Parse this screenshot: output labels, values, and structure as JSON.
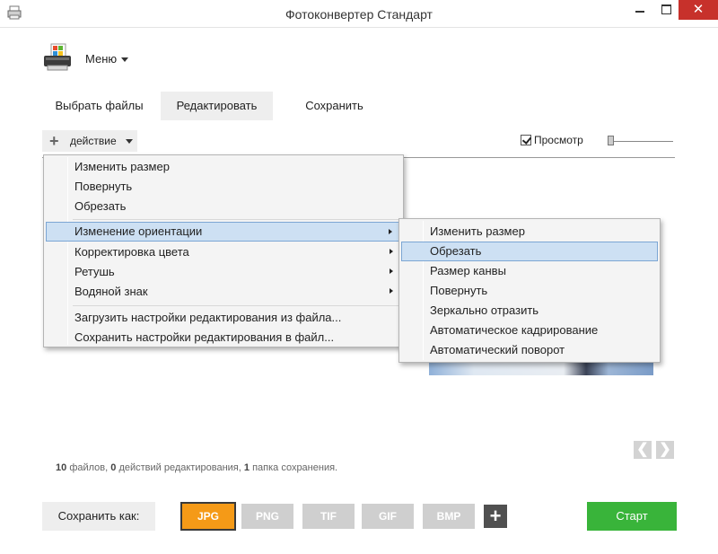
{
  "window": {
    "title": "Фотоконвертер Стандарт",
    "app_icon": "app-icon",
    "close_glyph": "✕"
  },
  "header": {
    "logo_icon": "photo-printer-logo-icon",
    "menu_label": "Меню"
  },
  "tabs": [
    {
      "label": "Выбрать файлы",
      "active": false
    },
    {
      "label": "Редактировать",
      "active": true
    },
    {
      "label": "Сохранить",
      "active": false
    }
  ],
  "toolbar": {
    "action_label": "действие",
    "preview_label": "Просмотр",
    "preview_checked": true
  },
  "action_menu": {
    "group1": [
      "Изменить размер",
      "Повернуть",
      "Обрезать"
    ],
    "group2": [
      {
        "label": "Изменение ориентации",
        "submenu": true,
        "highlighted": true
      },
      {
        "label": "Корректировка цвета",
        "submenu": true,
        "highlighted": false
      },
      {
        "label": "Ретушь",
        "submenu": true,
        "highlighted": false
      },
      {
        "label": "Водяной знак",
        "submenu": true,
        "highlighted": false
      }
    ],
    "group3": [
      "Загрузить настройки редактирования из файла...",
      "Сохранить настройки редактирования в файл..."
    ]
  },
  "orientation_submenu": [
    {
      "label": "Изменить размер",
      "highlighted": false
    },
    {
      "label": "Обрезать",
      "highlighted": true
    },
    {
      "label": "Размер канвы",
      "highlighted": false
    },
    {
      "label": "Повернуть",
      "highlighted": false
    },
    {
      "label": "Зеркально отразить",
      "highlighted": false
    },
    {
      "label": "Автоматическое кадрирование",
      "highlighted": false
    },
    {
      "label": "Автоматический поворот",
      "highlighted": false
    }
  ],
  "navigation": {
    "prev_glyph": "❮",
    "next_glyph": "❯"
  },
  "status": {
    "files_count": "10",
    "files_label": "файлов,",
    "actions_count": "0",
    "actions_label": "действий редактирования,",
    "folders_count": "1",
    "folders_label": "папка сохранения."
  },
  "footer": {
    "save_as_label": "Сохранить как:",
    "formats": [
      {
        "label": "JPG",
        "active": true
      },
      {
        "label": "PNG",
        "active": false
      },
      {
        "label": "TIF",
        "active": false
      },
      {
        "label": "GIF",
        "active": false
      },
      {
        "label": "BMP",
        "active": false
      }
    ],
    "add_format_glyph": "+",
    "start_label": "Старт"
  },
  "colors": {
    "accent_orange": "#f59a17",
    "start_green": "#39b43a",
    "close_red": "#c7312b",
    "menu_highlight": "#cde0f3"
  }
}
